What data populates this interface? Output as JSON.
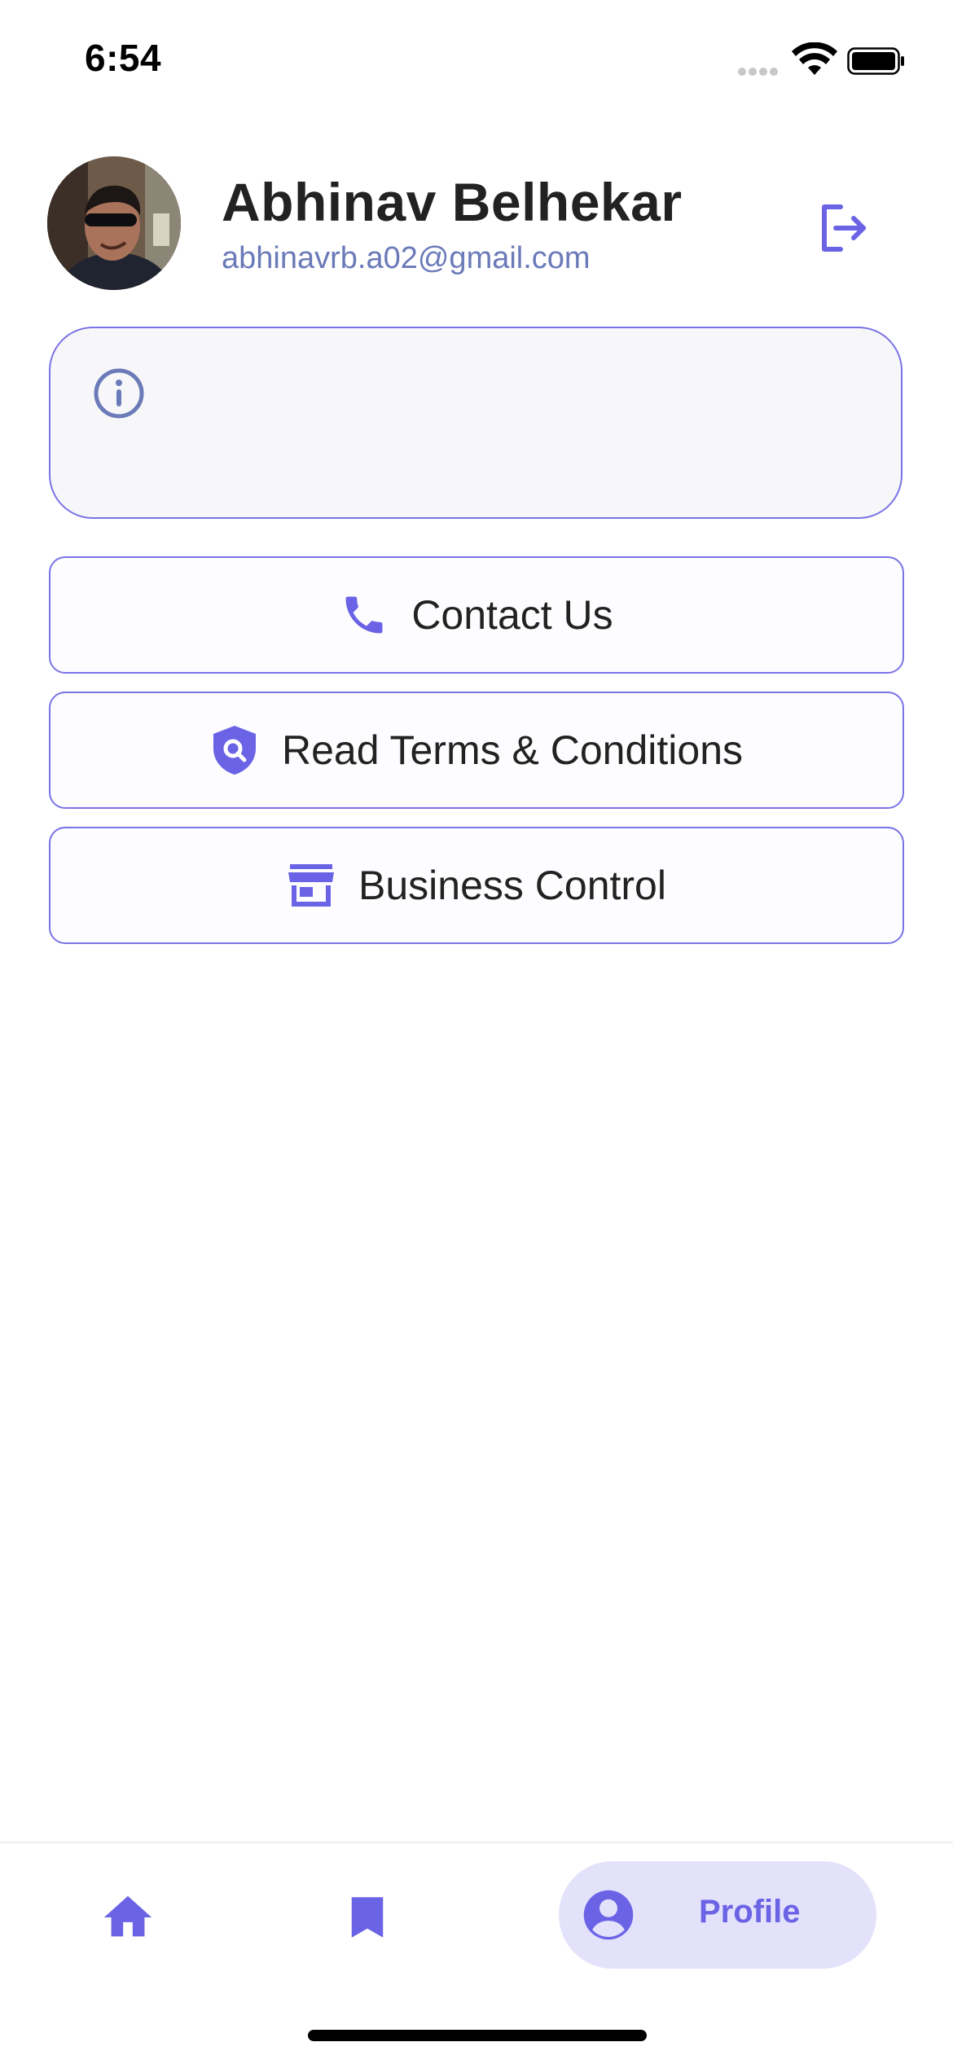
{
  "status_bar": {
    "time": "6:54"
  },
  "profile": {
    "name": "Abhinav Belhekar",
    "email": "abhinavrb.a02@gmail.com"
  },
  "info_card": {
    "text": ""
  },
  "actions": [
    {
      "label": "Contact Us",
      "icon": "phone-icon"
    },
    {
      "label": "Read Terms & Conditions",
      "icon": "shield-search-icon"
    },
    {
      "label": "Business Control",
      "icon": "store-icon"
    }
  ],
  "bottom_nav": {
    "items": [
      {
        "icon": "home-icon"
      },
      {
        "icon": "bookmark-icon"
      },
      {
        "icon": "user-circle-icon",
        "label": "Profile",
        "active": true
      }
    ]
  },
  "colors": {
    "accent": "#6b63e6",
    "border": "#7b73e6",
    "email": "#6b7ab8",
    "info_icon": "#6b7ab8",
    "active_tab_bg": "#e4e2fb"
  }
}
